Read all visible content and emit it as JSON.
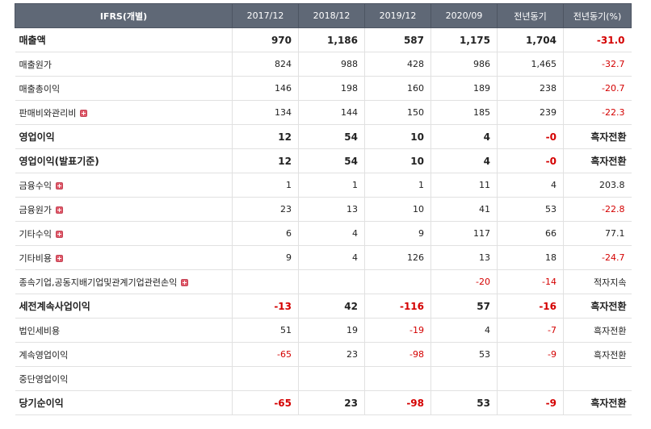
{
  "header": [
    "IFRS(개별)",
    "2017/12",
    "2018/12",
    "2019/12",
    "2020/09",
    "전년동기",
    "전년동기(%)"
  ],
  "rows": [
    {
      "label": "매출액",
      "bold": true,
      "plus": false,
      "cells": [
        "970",
        "1,186",
        "587",
        "1,175",
        "1,704",
        "-31.0"
      ]
    },
    {
      "label": "매출원가",
      "bold": false,
      "plus": false,
      "cells": [
        "824",
        "988",
        "428",
        "986",
        "1,465",
        "-32.7"
      ]
    },
    {
      "label": "매출총이익",
      "bold": false,
      "plus": false,
      "cells": [
        "146",
        "198",
        "160",
        "189",
        "238",
        "-20.7"
      ]
    },
    {
      "label": "판매비와관리비",
      "bold": false,
      "plus": true,
      "cells": [
        "134",
        "144",
        "150",
        "185",
        "239",
        "-22.3"
      ]
    },
    {
      "label": "영업이익",
      "bold": true,
      "plus": false,
      "cells": [
        "12",
        "54",
        "10",
        "4",
        "-0",
        "흑자전환"
      ]
    },
    {
      "label": "영업이익(발표기준)",
      "bold": true,
      "plus": false,
      "cells": [
        "12",
        "54",
        "10",
        "4",
        "-0",
        "흑자전환"
      ]
    },
    {
      "label": "금융수익",
      "bold": false,
      "plus": true,
      "cells": [
        "1",
        "1",
        "1",
        "11",
        "4",
        "203.8"
      ]
    },
    {
      "label": "금융원가",
      "bold": false,
      "plus": true,
      "cells": [
        "23",
        "13",
        "10",
        "41",
        "53",
        "-22.8"
      ]
    },
    {
      "label": "기타수익",
      "bold": false,
      "plus": true,
      "cells": [
        "6",
        "4",
        "9",
        "117",
        "66",
        "77.1"
      ]
    },
    {
      "label": "기타비용",
      "bold": false,
      "plus": true,
      "cells": [
        "9",
        "4",
        "126",
        "13",
        "18",
        "-24.7"
      ]
    },
    {
      "label": "종속기업,공동지배기업및관계기업관련손익",
      "bold": false,
      "plus": true,
      "cells": [
        "",
        "",
        "",
        "-20",
        "-14",
        "적자지속"
      ]
    },
    {
      "label": "세전계속사업이익",
      "bold": true,
      "plus": false,
      "cells": [
        "-13",
        "42",
        "-116",
        "57",
        "-16",
        "흑자전환"
      ]
    },
    {
      "label": "법인세비용",
      "bold": false,
      "plus": false,
      "cells": [
        "51",
        "19",
        "-19",
        "4",
        "-7",
        "흑자전환"
      ]
    },
    {
      "label": "계속영업이익",
      "bold": false,
      "plus": false,
      "cells": [
        "-65",
        "23",
        "-98",
        "53",
        "-9",
        "흑자전환"
      ]
    },
    {
      "label": "중단영업이익",
      "bold": false,
      "plus": false,
      "cells": [
        "",
        "",
        "",
        "",
        "",
        ""
      ]
    },
    {
      "label": "당기순이익",
      "bold": true,
      "plus": false,
      "cells": [
        "-65",
        "23",
        "-98",
        "53",
        "-9",
        "흑자전환"
      ]
    }
  ],
  "colors": {
    "header_bg": "#5f6876",
    "negative": "#d40000",
    "plus_icon": "#e05a6a"
  }
}
